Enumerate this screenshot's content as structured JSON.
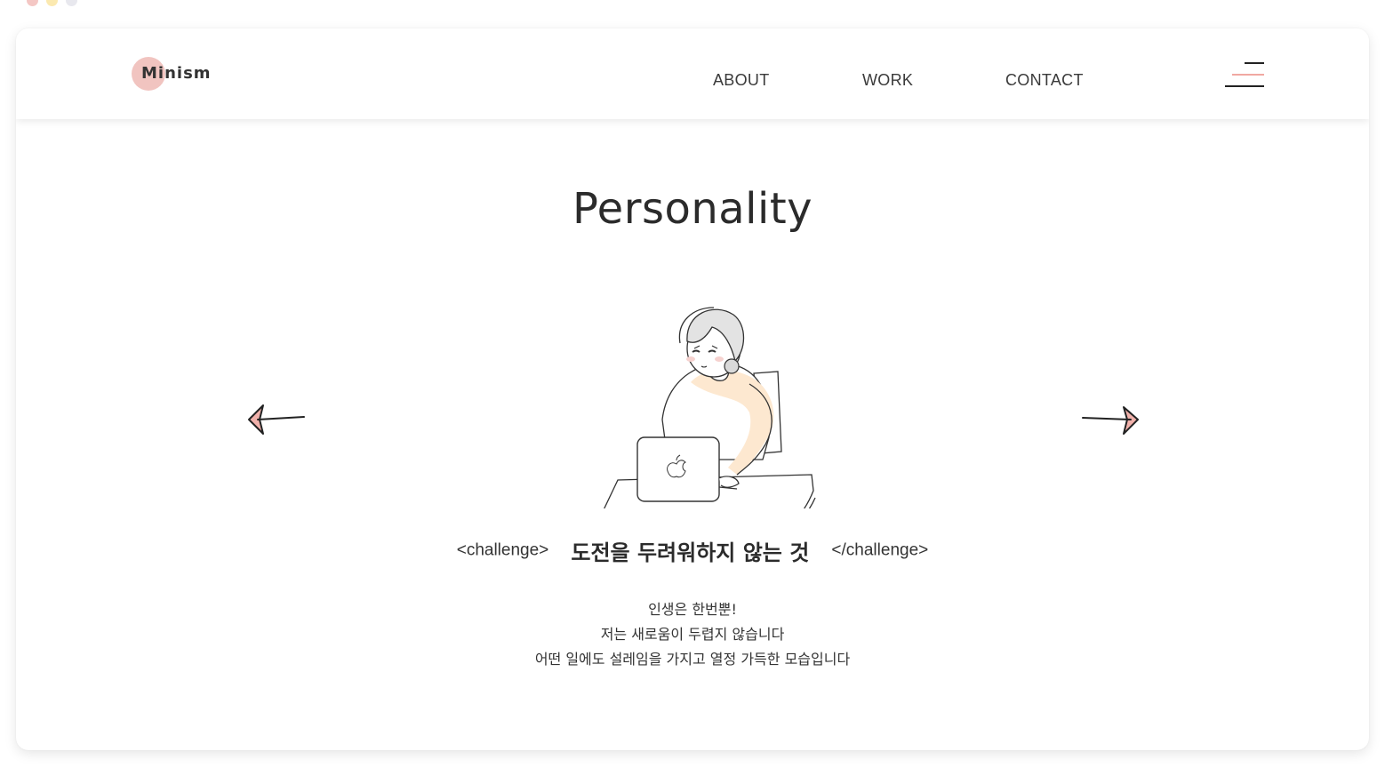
{
  "window": {
    "dot_colors": [
      "#f4c7c4",
      "#fbe9b0",
      "#e8e8ee"
    ]
  },
  "header": {
    "logo": "Minism",
    "nav": [
      {
        "label": "ABOUT"
      },
      {
        "label": "WORK"
      },
      {
        "label": "CONTACT"
      }
    ],
    "menu_icon": "hamburger-menu-icon"
  },
  "main": {
    "title": "Personality",
    "illustration": "woman-at-laptop-illustration",
    "prev_icon": "arrow-left-icon",
    "next_icon": "arrow-right-icon",
    "challenge": {
      "open_tag": "<challenge>",
      "text": "도전을 두려워하지 않는 것",
      "close_tag": "</challenge>"
    },
    "description": [
      "인생은 한번뿐!",
      "저는 새로움이 두렵지 않습니다",
      "어떤 일에도 설레임을 가지고 열정 가득한 모습입니다"
    ]
  },
  "colors": {
    "accent_pink": "#f1c4c0",
    "accent_peach": "#fde8d0",
    "text": "#2b2b2b"
  }
}
